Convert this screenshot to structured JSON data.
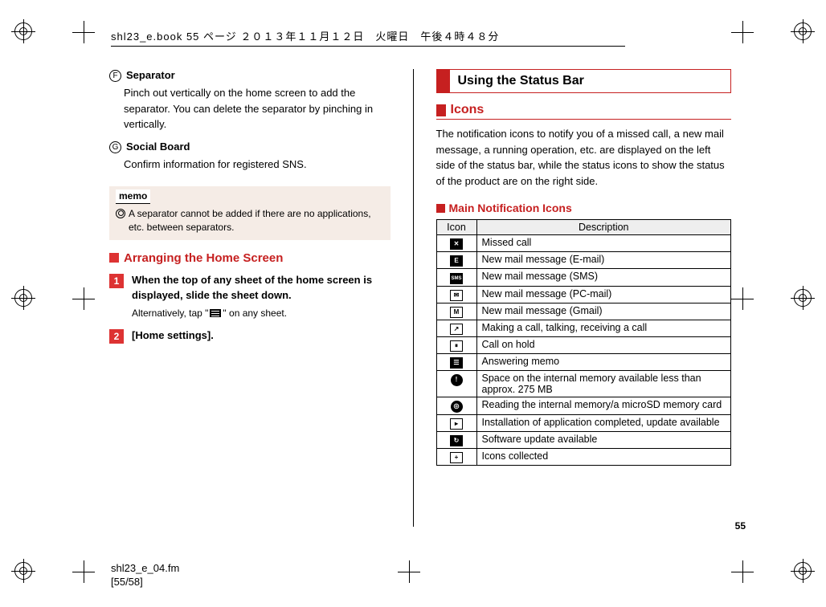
{
  "book_info": "shl23_e.book  55 ページ  ２０１３年１１月１２日　火曜日　午後４時４８分",
  "left": {
    "sep_num": "F",
    "sep_title": "Separator",
    "sep_body": "Pinch out vertically on the home screen to add the separator. You can delete the separator by pinching in vertically.",
    "sb_num": "G",
    "sb_title": "Social Board",
    "sb_body": "Confirm information for registered SNS.",
    "memo_label": "memo",
    "memo_text": "A separator cannot be added if there are no applications, etc. between separators.",
    "arr_head": "Arranging the Home Screen",
    "step1": "When the top of any sheet of the home screen is displayed, slide the sheet down.",
    "step1_alt_pre": "Alternatively, tap \"",
    "step1_alt_post": "\" on any sheet.",
    "step2": "[Home settings]."
  },
  "right": {
    "section": "Using the Status Bar",
    "icons_head": "Icons",
    "icons_para": "The notification icons to notify you of a missed call, a new mail message, a running operation, etc. are displayed on the left side of the status bar, while the status icons to show the status of the product are on the right side.",
    "main_icons_head": "Main Notification Icons",
    "th_icon": "Icon",
    "th_desc": "Description",
    "rows": [
      {
        "d": "Missed call"
      },
      {
        "d": "New mail message (E-mail)"
      },
      {
        "d": "New mail message (SMS)"
      },
      {
        "d": "New mail message (PC-mail)"
      },
      {
        "d": "New mail message (Gmail)"
      },
      {
        "d": "Making a call, talking, receiving a call"
      },
      {
        "d": "Call on hold"
      },
      {
        "d": "Answering memo"
      },
      {
        "d": "Space on the internal memory available less than approx. 275 MB"
      },
      {
        "d": "Reading the internal memory/a microSD memory card"
      },
      {
        "d": "Installation of application completed, update available"
      },
      {
        "d": "Software update available"
      },
      {
        "d": "Icons collected"
      }
    ]
  },
  "page_num": "55",
  "footer_file": "shl23_e_04.fm",
  "footer_pages": "[55/58]"
}
